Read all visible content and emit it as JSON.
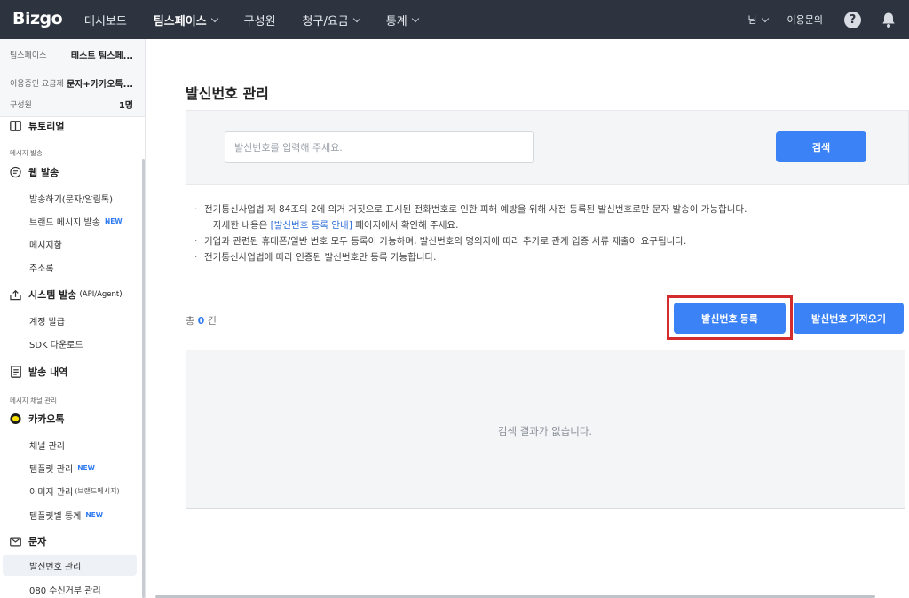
{
  "header": {
    "logo": "Bizgo",
    "nav": [
      {
        "label": "대시보드",
        "dropdown": false,
        "bold": false
      },
      {
        "label": "팀스페이스",
        "dropdown": true,
        "bold": true
      },
      {
        "label": "구성원",
        "dropdown": false,
        "bold": false
      },
      {
        "label": "청구/요금",
        "dropdown": true,
        "bold": false
      },
      {
        "label": "통계",
        "dropdown": true,
        "bold": false
      }
    ],
    "user_label": "님",
    "inquiry_label": "이용문의",
    "help_label": "?"
  },
  "sidebar": {
    "workspace": {
      "key": "팀스페이스",
      "value": "테스트 팀스페..."
    },
    "plan": {
      "key": "이용중인 요금제",
      "value": "문자+카카오톡..."
    },
    "members": {
      "key": "구성원",
      "value": "1명"
    },
    "tutorial": "튜토리얼",
    "section_message": "메시지 발송",
    "web_send": "웹 발송",
    "web_items": [
      {
        "label": "발송하기(문자/알림톡)",
        "badge": ""
      },
      {
        "label": "브랜드 메시지 발송",
        "badge": "NEW"
      },
      {
        "label": "메시지함",
        "badge": ""
      },
      {
        "label": "주소록",
        "badge": ""
      }
    ],
    "system_send": "시스템 발송",
    "system_send_extra": "(API/Agent)",
    "system_items": [
      "계정 발급",
      "SDK 다운로드"
    ],
    "history": "발송 내역",
    "section_channel": "메시지 채널 관리",
    "kakao": "카카오톡",
    "kakao_items": [
      {
        "label": "채널 관리",
        "badge": "",
        "extra": ""
      },
      {
        "label": "템플릿 관리",
        "badge": "NEW",
        "extra": ""
      },
      {
        "label": "이미지 관리",
        "badge": "",
        "extra": "(브랜드메시지)"
      },
      {
        "label": "템플릿별 통계",
        "badge": "NEW",
        "extra": ""
      }
    ],
    "sms": "문자",
    "sms_items": [
      "발신번호 관리",
      "080 수신거부 관리"
    ]
  },
  "main": {
    "title": "발신번호 관리",
    "search_placeholder": "발신번호를 입력해 주세요.",
    "search_button": "검색",
    "notices": {
      "line1": "전기통신사업법 제 84조의 2에 의거 거짓으로 표시된 전화번호로 인한 피해 예방을 위해 사전 등록된 발신번호로만 문자 발송이 가능합니다.",
      "line2_prefix": "자세한 내용은 ",
      "line2_link": "[발신번호 등록 안내]",
      "line2_suffix": " 페이지에서 확인해 주세요.",
      "line3": "기업과 관련된 휴대폰/일반 번호 모두 등록이 가능하며, 발신번호의 명의자에 따라 추가로 관계 입증 서류 제출이 요구됩니다.",
      "line4": "전기통신사업법에 따라 인증된 발신번호만 등록 가능합니다."
    },
    "count_prefix": "총 ",
    "count_value": "0",
    "count_suffix": " 건",
    "register_button": "발신번호 등록",
    "import_button": "발신번호 가져오기",
    "empty_message": "검색 결과가 없습니다."
  },
  "colors": {
    "topbar": "#2d3440",
    "primary": "#3b82f6",
    "highlight": "#d42c2c"
  }
}
